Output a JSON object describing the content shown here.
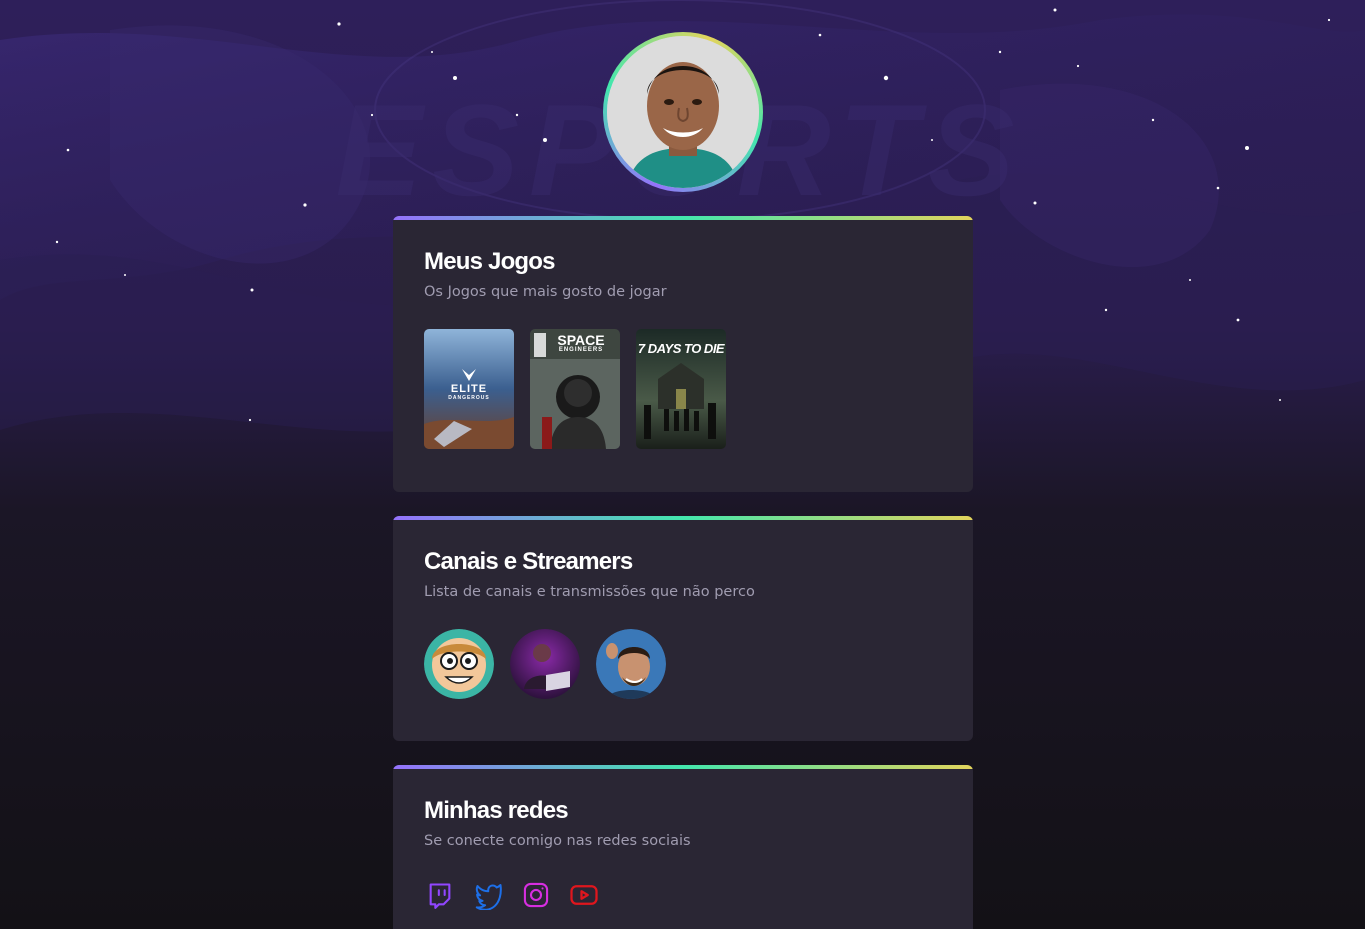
{
  "colors": {
    "card_bg": "#2a2634",
    "gradient_start": "#9572fc",
    "gradient_mid": "#43e7ad",
    "gradient_end": "#e2d45c",
    "page_bg": "#141216",
    "twitch": "#9146ff",
    "twitter": "#1d6fe8",
    "instagram": "#d62ee0",
    "youtube": "#e0161d"
  },
  "background": {
    "watermark_text": "ESPORTS"
  },
  "profile": {
    "avatar_icon": "profile-photo"
  },
  "games_card": {
    "title": "Meus Jogos",
    "subtitle": "Os Jogos que mais gosto de jogar",
    "games": [
      {
        "cover_text": "ELITE",
        "cover_subtext": "DANGEROUS"
      },
      {
        "cover_text": "SPACE",
        "cover_subtext": "ENGINEERS"
      },
      {
        "cover_text": "7 DAYS TO DIE",
        "cover_subtext": ""
      }
    ]
  },
  "streamers_card": {
    "title": "Canais e Streamers",
    "subtitle": "Lista de canais e transmissões que não perco",
    "streamers": [
      {
        "icon": "cartoon-avatar"
      },
      {
        "icon": "streamer-laptop-avatar"
      },
      {
        "icon": "streamer-selfie-avatar"
      }
    ]
  },
  "social_card": {
    "title": "Minhas redes",
    "subtitle": "Se conecte comigo nas redes sociais",
    "networks": [
      {
        "icon": "twitch-icon"
      },
      {
        "icon": "twitter-icon"
      },
      {
        "icon": "instagram-icon"
      },
      {
        "icon": "youtube-icon"
      }
    ]
  }
}
